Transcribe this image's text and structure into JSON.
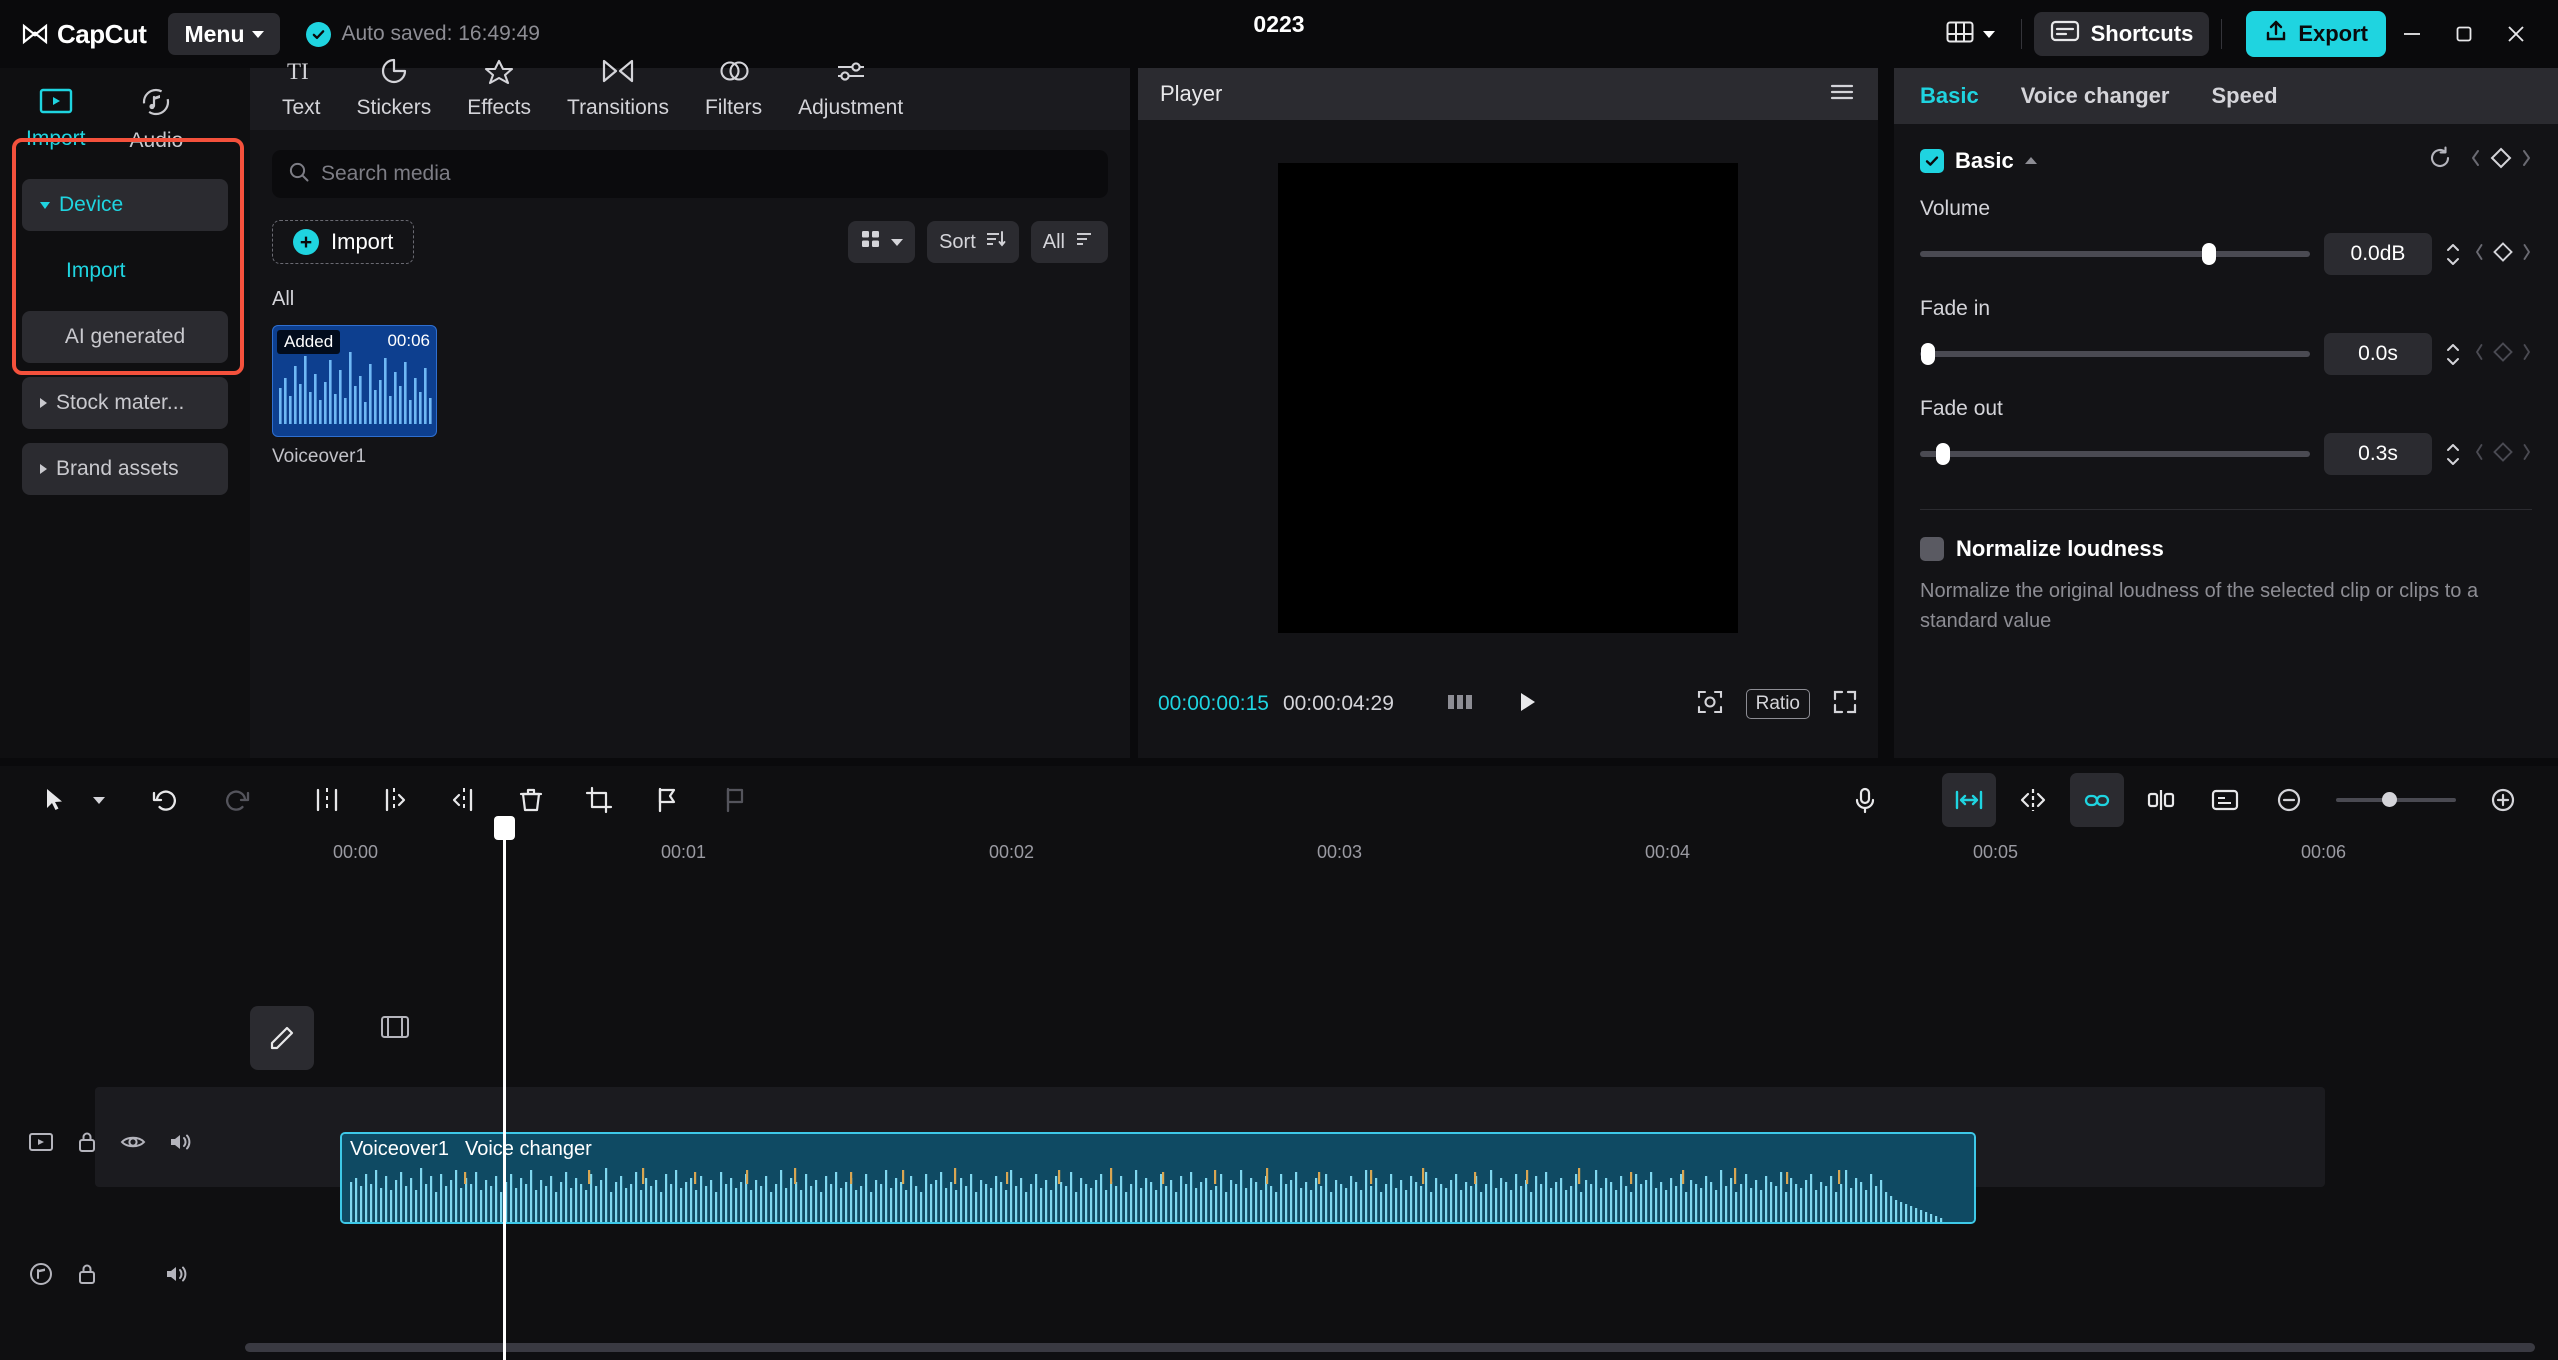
{
  "header": {
    "app_name": "CapCut",
    "menu_label": "Menu",
    "autosave_text": "Auto saved: 16:49:49",
    "project_title": "0223",
    "shortcuts_label": "Shortcuts",
    "export_label": "Export",
    "accent_color": "#1fd4e0",
    "icons": {
      "logo": "capcut-logo-icon",
      "layout": "layout-grid-icon",
      "shortcuts": "keyboard-icon",
      "export": "upload-share-icon",
      "minimize": "minimize-icon",
      "maximize": "restore-icon",
      "close": "close-icon"
    }
  },
  "sidebar": {
    "highlight_color": "#f4513c",
    "tabs": [
      {
        "label": "Import",
        "icon": "media-play-rect-icon",
        "active": true
      },
      {
        "label": "Audio",
        "icon": "music-note-icon",
        "active": false
      }
    ],
    "items": [
      {
        "label": "Device",
        "selected": true,
        "expandable": true,
        "expanded": true
      },
      {
        "label": "Import",
        "selected": false,
        "sub": true
      },
      {
        "label": "AI generated",
        "selected": false,
        "expandable": false
      },
      {
        "label": "Stock mater...",
        "selected": false,
        "expandable": true,
        "expanded": false
      },
      {
        "label": "Brand assets",
        "selected": false,
        "expandable": true,
        "expanded": false
      }
    ]
  },
  "media_panel": {
    "tabs": [
      {
        "label": "Text",
        "icon": "text-icon"
      },
      {
        "label": "Stickers",
        "icon": "sticker-icon"
      },
      {
        "label": "Effects",
        "icon": "star-effects-icon"
      },
      {
        "label": "Transitions",
        "icon": "transitions-icon"
      },
      {
        "label": "Filters",
        "icon": "filters-icon"
      },
      {
        "label": "Adjustment",
        "icon": "adjustment-sliders-icon"
      }
    ],
    "search_placeholder": "Search media",
    "search_value": "",
    "import_label": "Import",
    "sort_label": "Sort",
    "filter_label": "All",
    "section_label": "All",
    "items": [
      {
        "name": "Voiceover1",
        "badge": "Added",
        "duration": "00:06",
        "type": "audio"
      }
    ]
  },
  "player": {
    "title": "Player",
    "current_time": "00:00:00:15",
    "total_time": "00:00:04:29",
    "ratio_label": "Ratio",
    "icons": {
      "menu": "hamburger-menu-icon",
      "frames": "frames-icon",
      "play": "play-icon",
      "crop": "crop-focus-icon",
      "fullscreen": "fullscreen-icon"
    }
  },
  "properties": {
    "tabs": [
      {
        "label": "Basic",
        "active": true
      },
      {
        "label": "Voice changer",
        "active": false
      },
      {
        "label": "Speed",
        "active": false
      }
    ],
    "section_title": "Basic",
    "section_enabled": true,
    "controls": [
      {
        "label": "Volume",
        "value": "0.0dB",
        "slider_pct": 74,
        "keyframe_active": true
      },
      {
        "label": "Fade in",
        "value": "0.0s",
        "slider_pct": 2,
        "keyframe_active": false
      },
      {
        "label": "Fade out",
        "value": "0.3s",
        "slider_pct": 6,
        "keyframe_active": false
      }
    ],
    "normalize": {
      "label": "Normalize loudness",
      "enabled": false,
      "description": "Normalize the original loudness of the selected clip or clips to a standard value"
    }
  },
  "timeline": {
    "tools": [
      {
        "name": "select-cursor-icon"
      },
      {
        "name": "cursor-dropdown-icon"
      },
      {
        "name": "undo-icon"
      },
      {
        "name": "redo-icon"
      },
      {
        "name": "split-icon"
      },
      {
        "name": "trim-left-icon"
      },
      {
        "name": "trim-right-icon"
      },
      {
        "name": "delete-icon"
      },
      {
        "name": "crop-icon"
      },
      {
        "name": "flag-marker-icon"
      },
      {
        "name": "flag-marker-off-icon"
      }
    ],
    "right_tools": [
      {
        "name": "mic-record-icon"
      },
      {
        "name": "auto-fit-icon"
      },
      {
        "name": "mirror-icon"
      },
      {
        "name": "link-icon"
      },
      {
        "name": "keyframe-split-icon"
      },
      {
        "name": "caption-icon"
      },
      {
        "name": "zoom-out-icon"
      },
      {
        "name": "zoom-in-icon"
      }
    ],
    "ruler_ticks": [
      "00:00",
      "00:01",
      "00:02",
      "00:03",
      "00:04",
      "00:05",
      "00:06"
    ],
    "track_controls": [
      {
        "icons": [
          "track-video-icon",
          "lock-icon",
          "eye-icon",
          "volume-icon"
        ]
      },
      {
        "icons": [
          "track-audio-icon",
          "lock-icon",
          "volume-icon"
        ]
      }
    ],
    "clip": {
      "name": "Voiceover1",
      "effect_label": "Voice changer",
      "color": "#0f4a63",
      "border_color": "#3ec9e8"
    }
  }
}
